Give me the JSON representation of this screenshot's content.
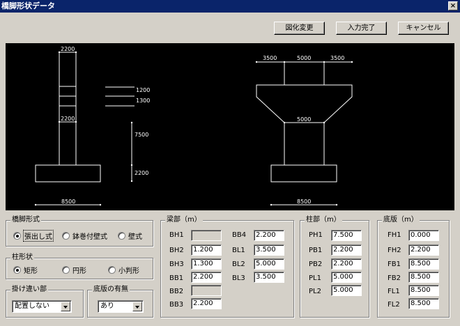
{
  "window": {
    "title": "橋脚形状データ",
    "close_label": "×"
  },
  "toolbar": {
    "change_label": "図化変更",
    "done_label": "入力完了",
    "cancel_label": "キャンセル"
  },
  "drawing": {
    "side": {
      "top_width": "2200",
      "h1": "1200",
      "h2": "1300",
      "col_width": "2200",
      "col_height": "7500",
      "footing_height": "2200",
      "footing_width": "8500"
    },
    "front": {
      "dim_left": "3500",
      "dim_mid": "5000",
      "dim_right": "3500",
      "col_width": "5000",
      "footing_width": "8500"
    }
  },
  "pier_type": {
    "title": "橋脚形式",
    "options": [
      "張出し式",
      "鉢巻付壁式",
      "壁式"
    ],
    "selected": 0
  },
  "column_shape": {
    "title": "柱形状",
    "options": [
      "矩形",
      "円形",
      "小判形"
    ],
    "selected": 0
  },
  "offset": {
    "title": "掛け違い部",
    "value": "配置しない"
  },
  "footing_exists": {
    "title": "底版の有無",
    "value": "あり"
  },
  "beam": {
    "title": "梁部（m）",
    "left": [
      {
        "label": "BH1",
        "value": "",
        "disabled": true
      },
      {
        "label": "BH2",
        "value": "1.200"
      },
      {
        "label": "BH3",
        "value": "1.300"
      },
      {
        "label": "BB1",
        "value": "2.200"
      },
      {
        "label": "BB2",
        "value": "",
        "disabled": true
      },
      {
        "label": "BB3",
        "value": "2.200"
      }
    ],
    "right": [
      {
        "label": "BB4",
        "value": "2.200"
      },
      {
        "label": "BL1",
        "value": "3.500"
      },
      {
        "label": "BL2",
        "value": "5.000"
      },
      {
        "label": "BL3",
        "value": "3.500"
      }
    ]
  },
  "column": {
    "title": "柱部（m）",
    "fields": [
      {
        "label": "PH1",
        "value": "7.500"
      },
      {
        "label": "PB1",
        "value": "2.200"
      },
      {
        "label": "PB2",
        "value": "2.200"
      },
      {
        "label": "PL1",
        "value": "5.000"
      },
      {
        "label": "PL2",
        "value": "5.000"
      }
    ]
  },
  "footing": {
    "title": "底版（m）",
    "fields": [
      {
        "label": "FH1",
        "value": "0.000"
      },
      {
        "label": "FH2",
        "value": "2.200"
      },
      {
        "label": "FB1",
        "value": "8.500"
      },
      {
        "label": "FB2",
        "value": "8.500"
      },
      {
        "label": "FL1",
        "value": "8.500"
      },
      {
        "label": "FL2",
        "value": "8.500"
      }
    ]
  }
}
